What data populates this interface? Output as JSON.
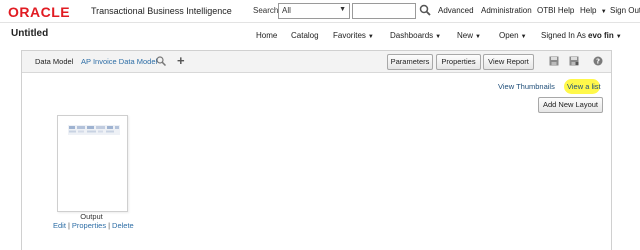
{
  "header": {
    "brand": "ORACLE",
    "product": "Transactional Business Intelligence",
    "search_label": "Search",
    "search_scope": "All",
    "search_value": "",
    "links": {
      "advanced": "Advanced",
      "administration": "Administration",
      "otbi_help": "OTBI Help",
      "help": "Help",
      "sign_out": "Sign Out"
    }
  },
  "nav": {
    "page_title": "Untitled",
    "home": "Home",
    "catalog": "Catalog",
    "favorites": "Favorites",
    "dashboards": "Dashboards",
    "new": "New",
    "open": "Open",
    "signed_in_as_label": "Signed In As",
    "user": "evo fin"
  },
  "editor": {
    "data_model_label": "Data Model",
    "data_model_name": "AP Invoice Data Model",
    "buttons": {
      "parameters": "Parameters",
      "properties": "Properties",
      "view_report": "View Report",
      "add_new_layout": "Add New Layout"
    },
    "view_thumbnails": "View Thumbnails",
    "view_list": "View a list",
    "highlight_color": "#fff84a",
    "layout": {
      "name": "Output",
      "actions": {
        "edit": "Edit",
        "properties": "Properties",
        "delete": "Delete"
      }
    }
  },
  "colors": {
    "brand_red": "#e11b22",
    "link_blue": "#2e6ea6"
  }
}
